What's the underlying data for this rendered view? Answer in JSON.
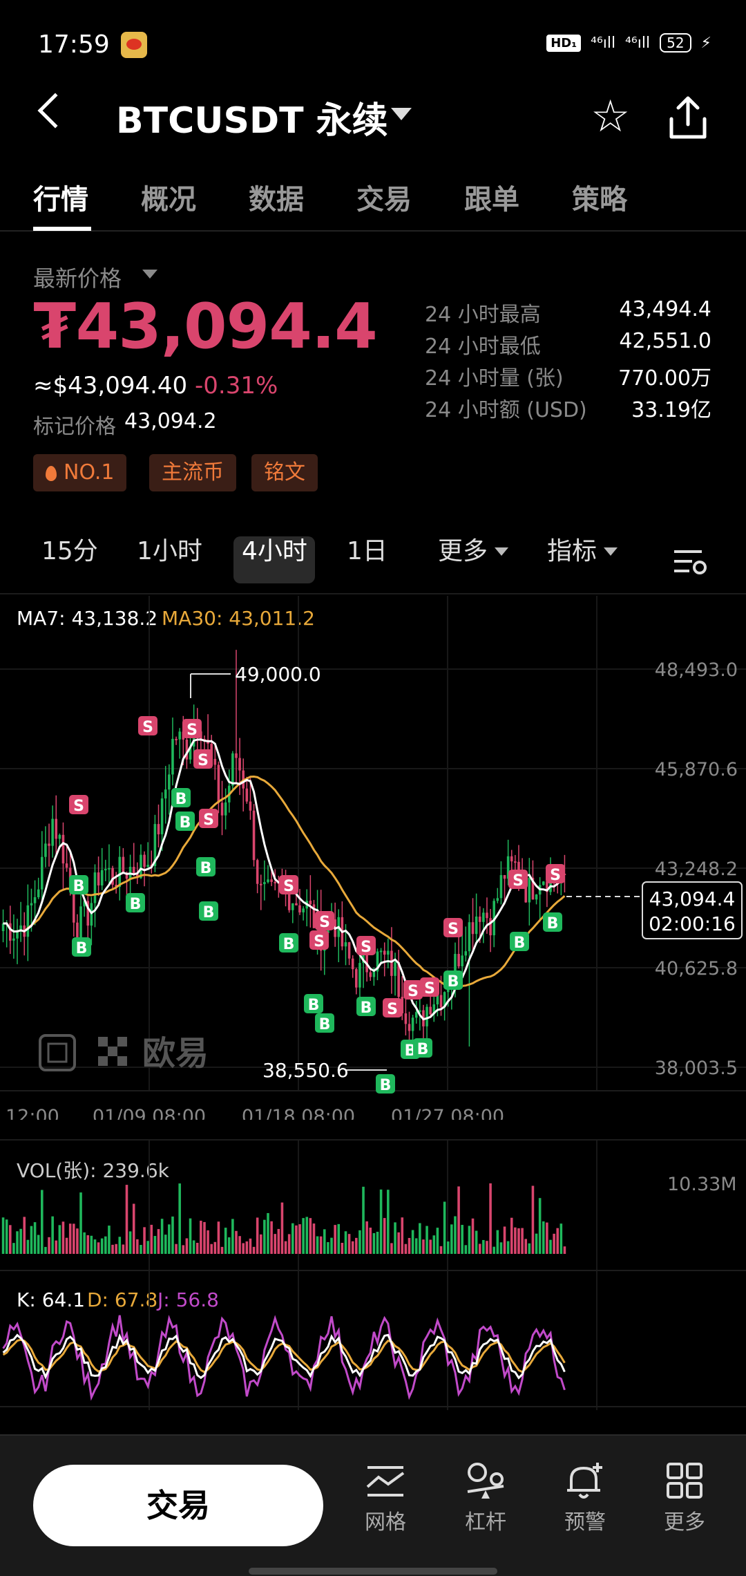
{
  "status_bar": {
    "time": "17:59",
    "hd": "HD₁",
    "network1": "⁴⁶ıll",
    "network2": "⁴⁶ıll",
    "battery": "52"
  },
  "header": {
    "title": "BTCUSDT 永续"
  },
  "tabs": [
    "行情",
    "概况",
    "数据",
    "交易",
    "跟单",
    "策略"
  ],
  "price": {
    "label": "最新价格",
    "last": "₮43,094.4",
    "usd": "≈$43,094.40",
    "change": "-0.31%",
    "mark_label": "标记价格",
    "mark_value": "43,094.2"
  },
  "stats": [
    {
      "label": "24 小时最高",
      "value": "43,494.4"
    },
    {
      "label": "24 小时最低",
      "value": "42,551.0"
    },
    {
      "label": "24 小时量 (张)",
      "value": "770.00万"
    },
    {
      "label": "24 小时额 (USD)",
      "value": "33.19亿"
    }
  ],
  "badges": [
    "NO.1",
    "主流币",
    "铭文"
  ],
  "intervals": [
    "15分",
    "1小时",
    "4小时",
    "1日",
    "更多",
    "指标"
  ],
  "active_interval": "4小时",
  "indicators": {
    "ma7": "MA7: 43,138.2",
    "ma30": "MA30: 43,011.2",
    "vol": "VOL(张): 239.6k",
    "vol_max": "10.33M",
    "k": "K: 64.1",
    "d": "D: 67.8",
    "j": "J: 56.8"
  },
  "chart": {
    "y_ticks": [
      "48,493.0",
      "45,870.6",
      "43,248.2",
      "40,625.8",
      "38,003.5"
    ],
    "x_ticks": [
      "12:00",
      "01/09 08:00",
      "01/18 08:00",
      "01/27 08:00"
    ],
    "high_marker": "49,000.0",
    "low_marker": "38,550.6",
    "current_price": "43,094.4",
    "countdown": "02:00:16",
    "watermark": "欧易"
  },
  "chart_data": {
    "type": "candlestick",
    "symbol": "BTCUSDT",
    "interval": "4小时",
    "y_range": [
      38003.5,
      49000.0
    ],
    "y_ticks": [
      48493.0,
      45870.6,
      43248.2,
      40625.8,
      38003.5
    ],
    "x_ticks": [
      "12:00",
      "01/09 08:00",
      "01/18 08:00",
      "01/27 08:00"
    ],
    "close_approx": [
      41800,
      41600,
      41900,
      43000,
      44600,
      43600,
      41700,
      42100,
      43300,
      43000,
      43200,
      43300,
      43500,
      44700,
      46800,
      46400,
      47300,
      46100,
      44600,
      46300,
      45200,
      42600,
      42500,
      42700,
      42400,
      42200,
      41500,
      42000,
      41000,
      40400,
      40800,
      40900,
      40600,
      39500,
      39100,
      39800,
      40000,
      40700,
      41600,
      42200,
      41900,
      43100,
      43300,
      42600,
      43100,
      43000,
      43094.4
    ],
    "ma7_last": 43138.2,
    "ma30_last": 43011.2,
    "high": 49000.0,
    "low": 38550.6,
    "last": 43094.4,
    "volume_max": "10.33M",
    "kdj": {
      "K": 64.1,
      "D": 67.8,
      "J": 56.8
    }
  },
  "bottom_nav": {
    "trade": "交易",
    "items": [
      "网格",
      "杠杆",
      "预警",
      "更多"
    ]
  },
  "colors": {
    "up": "#1fb85c",
    "down": "#d9456d",
    "ma7": "#ffffff",
    "ma30": "#e8a93a",
    "kdj_j": "#c14ac9"
  }
}
